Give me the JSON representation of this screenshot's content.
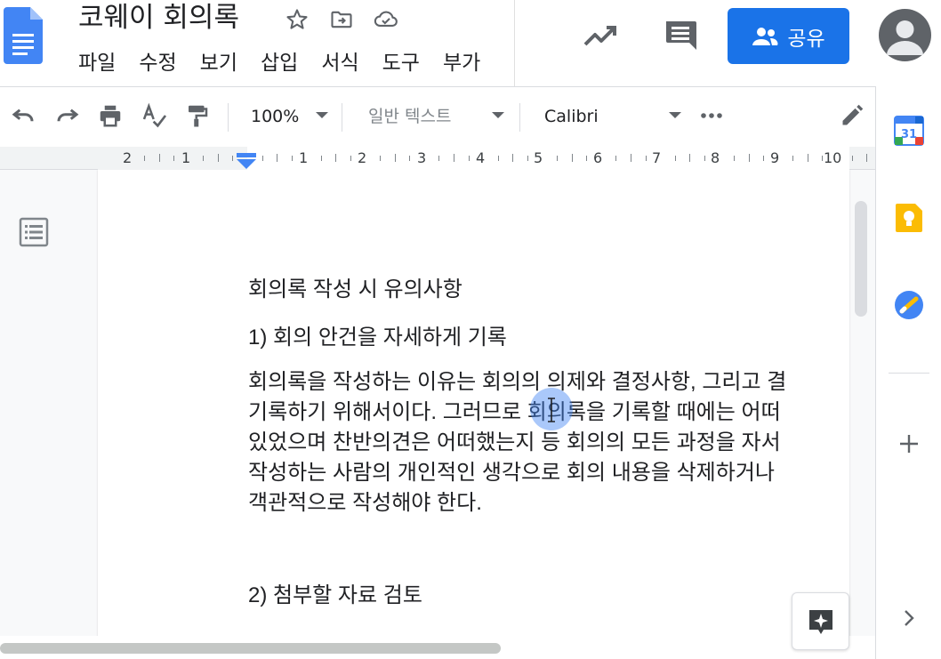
{
  "document": {
    "title": "코웨이 회의록",
    "menu": [
      "파일",
      "수정",
      "보기",
      "삽입",
      "서식",
      "도구",
      "부가"
    ]
  },
  "header": {
    "share_label": "공유",
    "icons": [
      "star-icon",
      "move-to-folder-icon",
      "cloud-saved-icon",
      "activity-trend-icon",
      "comment-history-icon",
      "share-person-icon",
      "account-avatar-icon"
    ]
  },
  "toolbar": {
    "zoom": "100%",
    "style": "일반 텍스트",
    "font": "Calibri",
    "icons": [
      "undo-icon",
      "redo-icon",
      "print-icon",
      "spellcheck-icon",
      "paint-format-icon",
      "more-options-icon",
      "editing-mode-pencil-icon"
    ]
  },
  "ruler": {
    "labels": [
      "2",
      "1",
      "1",
      "2",
      "3",
      "4",
      "5",
      "6",
      "7",
      "8",
      "9",
      "10"
    ]
  },
  "content": {
    "heading": "회의록 작성 시 유의사항",
    "item1": "1) 회의 안건을 자세하게 기록",
    "lines": [
      "회의록을 작성하는 이유는 회의의 의제와 결정사항, 그리고 결",
      "기록하기 위해서이다. 그러므로 회의록을 기록할 때에는 어떠",
      "있었으며 찬반의견은 어떠했는지 등 회의의 모든 과정을 자서",
      "작성하는 사람의 개인적인 생각으로 회의 내용을 삭제하거나",
      "객관적으로 작성해야 한다."
    ],
    "item2": "2) 첨부할 자료 검토"
  },
  "sidepanel": {
    "icons": [
      "calendar-icon",
      "keep-icon",
      "tasks-icon",
      "add-addon-icon",
      "expand-panel-chevron-icon"
    ],
    "calendar_day": "31"
  },
  "colors": {
    "accent": "#1a73e8",
    "docs_blue": "#4285f4",
    "keep_yellow": "#fbbc04"
  }
}
